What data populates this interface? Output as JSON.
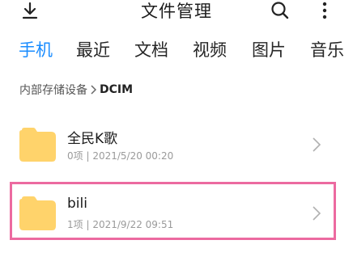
{
  "header": {
    "title": "文件管理",
    "left_icon": "download-icon",
    "right_icons": [
      "search-icon",
      "more-vertical-icon"
    ]
  },
  "tabs": [
    {
      "label": "手机",
      "active": true
    },
    {
      "label": "最近",
      "active": false
    },
    {
      "label": "文档",
      "active": false
    },
    {
      "label": "视频",
      "active": false
    },
    {
      "label": "图片",
      "active": false
    },
    {
      "label": "音乐",
      "active": false
    }
  ],
  "breadcrumb": {
    "parent": "内部存储设备",
    "current": "DCIM"
  },
  "files": [
    {
      "name": "全民K歌",
      "count": "0项",
      "date": "2021/5/20 00:20",
      "icon": "folder-icon"
    },
    {
      "name": "bili",
      "count": "1项",
      "date": "2021/9/22 09:51",
      "icon": "folder-icon",
      "highlighted": true
    }
  ],
  "colors": {
    "accent": "#1a8cff",
    "folder": "#ffd36b",
    "highlight": "#ec6aa0"
  }
}
